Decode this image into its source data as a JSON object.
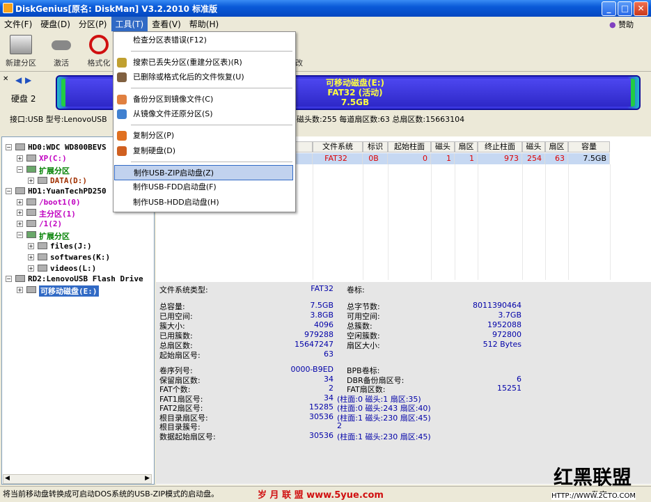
{
  "window": {
    "title": "DiskGenius[原名: DiskMan] V3.2.2010 标准版"
  },
  "menubar": {
    "items": [
      "文件(F)",
      "硬盘(D)",
      "分区(P)",
      "工具(T)",
      "查看(V)",
      "帮助(H)"
    ],
    "sponsor": "赞助"
  },
  "toolbar": {
    "items": [
      "新建分区",
      "激活",
      "格式化"
    ],
    "tail_label": "改"
  },
  "diskbar": {
    "disk_label": "硬盘 2",
    "partition_name": "可移动磁盘(E:)",
    "partition_fs": "FAT32 (活动)",
    "partition_size": "7.5GB",
    "info_left": "接口:USB  型号:LenovoUSB",
    "info_right": "磁头数:255  每道扇区数:63  总扇区数:15663104"
  },
  "tree": [
    {
      "label": "HD0:WDC WD800BEVS",
      "color": "#000"
    },
    {
      "label": "XP(C:)",
      "color": "#c000c0"
    },
    {
      "label": "扩展分区",
      "color": "#008000"
    },
    {
      "label": "DATA(D:)",
      "color": "#a03000"
    },
    {
      "label": "HD1:YuanTechPD250",
      "color": "#000"
    },
    {
      "label": "/boot1(0)",
      "color": "#c000c0"
    },
    {
      "label": "主分区(1)",
      "color": "#c000c0"
    },
    {
      "label": "/1(2)",
      "color": "#c000c0"
    },
    {
      "label": "扩展分区",
      "color": "#008000"
    },
    {
      "label": "files(J:)",
      "color": "#000"
    },
    {
      "label": "softwares(K:)",
      "color": "#000"
    },
    {
      "label": "videos(L:)",
      "color": "#000"
    },
    {
      "label": "RD2:LenovoUSB Flash Drive",
      "color": "#000"
    },
    {
      "label": "可移动磁盘(E:)",
      "color": "#fff"
    }
  ],
  "table": {
    "headers": [
      "态)",
      "文件系统",
      "标识",
      "起始柱面",
      "磁头",
      "扇区",
      "终止柱面",
      "磁头",
      "扇区",
      "容量"
    ],
    "row": [
      "",
      "FAT32",
      "0B",
      "0",
      "1",
      "1",
      "973",
      "254",
      "63",
      "7.5GB"
    ]
  },
  "details": {
    "fs_type_label": "文件系统类型:",
    "fs_type_value": "FAT32",
    "volume_label": "卷标:",
    "left": [
      [
        "总容量:",
        "7.5GB"
      ],
      [
        "已用空间:",
        "3.8GB"
      ],
      [
        "簇大小:",
        "4096"
      ],
      [
        "已用簇数:",
        "979288"
      ],
      [
        "总扇区数:",
        "15647247"
      ],
      [
        "起始扇区号:",
        "63"
      ]
    ],
    "right": [
      [
        "总字节数:",
        "8011390464"
      ],
      [
        "可用空间:",
        "3.7GB"
      ],
      [
        "总簇数:",
        "1952088"
      ],
      [
        "空闲簇数:",
        "972800"
      ],
      [
        "扇区大小:",
        "512 Bytes"
      ]
    ],
    "left2": [
      [
        "卷序列号:",
        "0000-B9ED"
      ],
      [
        "保留扇区数:",
        "34"
      ],
      [
        "FAT个数:",
        "2"
      ],
      [
        "FAT1扇区号:",
        "34 (柱面:0 磁头:1 扇区:35)"
      ],
      [
        "FAT2扇区号:",
        "15285 (柱面:0 磁头:243 扇区:40)"
      ],
      [
        "根目录扇区号:",
        "30536 (柱面:1 磁头:230 扇区:45)"
      ],
      [
        "根目录簇号:",
        "2"
      ],
      [
        "数据起始扇区号:",
        "30536 (柱面:1 磁头:230 扇区:45)"
      ]
    ],
    "right2": [
      [
        "BPB卷标:",
        ""
      ],
      [
        "DBR备份扇区号:",
        "6"
      ],
      [
        "FAT扇区数:",
        "15251"
      ]
    ]
  },
  "dropdown": {
    "items": [
      "检查分区表错误(F12)",
      "搜索已丢失分区(重建分区表)(R)",
      "已删除或格式化后的文件恢复(U)",
      "备份分区到镜像文件(C)",
      "从镜像文件还原分区(S)",
      "复制分区(P)",
      "复制硬盘(D)",
      "制作USB-ZIP启动盘(Z)",
      "制作USB-FDD启动盘(F)",
      "制作USB-HDD启动盘(H)"
    ],
    "highlighted_index": 7
  },
  "statusbar": {
    "text": "将当前移动盘转换成可启动DOS系统的USB-ZIP模式的启动盘。",
    "numlock": "数字"
  },
  "watermarks": {
    "site": "岁 月 联 盟  www.5yue.com",
    "logo": "红黑联盟",
    "url": "HTTP://WWW.2CTO.COM"
  }
}
